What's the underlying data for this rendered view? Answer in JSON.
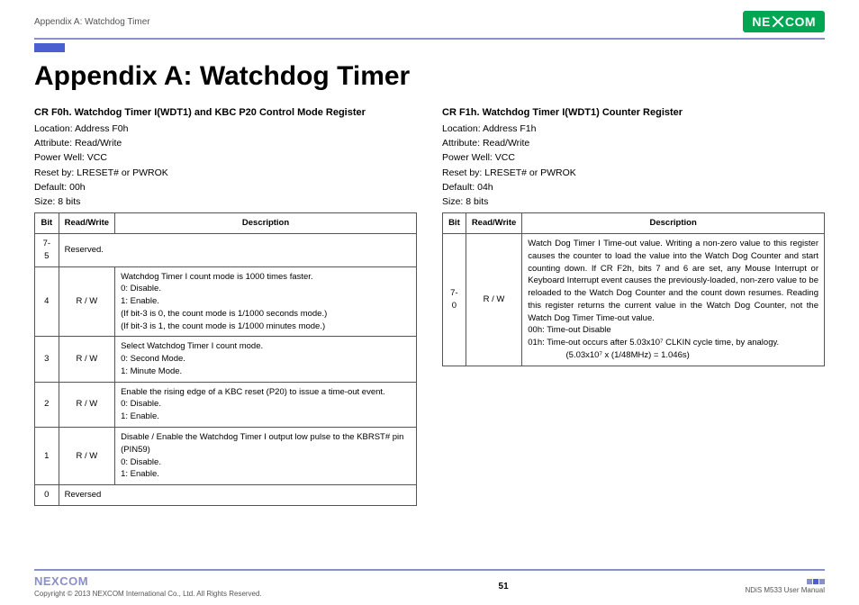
{
  "header": {
    "section": "Appendix A: Watchdog Timer",
    "brand": "NEXCOM"
  },
  "title": "Appendix A: Watchdog Timer",
  "left": {
    "heading": "CR F0h. Watchdog Timer I(WDT1) and KBC P20 Control Mode Register",
    "meta": [
      "Location: Address F0h",
      "Attribute: Read/Write",
      "Power Well: VCC",
      "Reset by: LRESET# or PWROK",
      "Default: 00h",
      "Size: 8 bits"
    ],
    "th": [
      "Bit",
      "Read/Write",
      "Description"
    ],
    "rows": [
      {
        "bit": "7-5",
        "rw": "",
        "desc": [
          "Reserved."
        ]
      },
      {
        "bit": "4",
        "rw": "R / W",
        "desc": [
          "Watchdog Timer I count mode is 1000 times faster.",
          "0: Disable.",
          "1: Enable.",
          "(If bit-3 is 0, the count mode is 1/1000 seconds mode.)",
          "(If bit-3 is 1, the count mode is 1/1000 minutes mode.)"
        ]
      },
      {
        "bit": "3",
        "rw": "R / W",
        "desc": [
          "Select Watchdog Timer I count mode.",
          "0: Second Mode.",
          "1: Minute Mode."
        ]
      },
      {
        "bit": "2",
        "rw": "R / W",
        "desc": [
          "Enable the rising edge of a KBC reset (P20) to issue a time-out event.",
          "0: Disable.",
          "1: Enable."
        ]
      },
      {
        "bit": "1",
        "rw": "R / W",
        "desc": [
          "Disable / Enable the Watchdog Timer I output low pulse to the KBRST# pin (PIN59)",
          "0: Disable.",
          "1: Enable."
        ]
      },
      {
        "bit": "0",
        "rw": "",
        "desc": [
          "Reversed"
        ]
      }
    ]
  },
  "right": {
    "heading": "CR F1h. Watchdog Timer I(WDT1) Counter Register",
    "meta": [
      "Location: Address F1h",
      "Attribute: Read/Write",
      "Power Well: VCC",
      "Reset by: LRESET# or PWROK",
      "Default: 04h",
      "Size: 8 bits"
    ],
    "th": [
      "Bit",
      "Read/Write",
      "Description"
    ],
    "rows": [
      {
        "bit": "7-0",
        "rw": "R / W",
        "desc": [
          "Watch Dog Timer I Time-out value. Writing a non-zero value to this register causes the counter to load the value into the Watch Dog Counter and start counting down. If CR F2h, bits 7 and 6 are set, any Mouse Interrupt or Keyboard Interrupt event causes the previously-loaded, non-zero value to be reloaded to the Watch Dog Counter and the count down resumes. Reading this register returns the current value in the Watch Dog Counter, not the Watch Dog Timer Time-out value.",
          "00h: Time-out Disable",
          "01h: Time-out occurs after 5.03x10⁷ CLKIN cycle time, by analogy.",
          "                (5.03x10⁷ x (1/48MHz) = 1.046s)"
        ]
      }
    ]
  },
  "footer": {
    "brand": "NEXCOM",
    "copyright": "Copyright © 2013 NEXCOM International Co., Ltd. All Rights Reserved.",
    "page": "51",
    "doc": "NDiS M533 User Manual"
  }
}
